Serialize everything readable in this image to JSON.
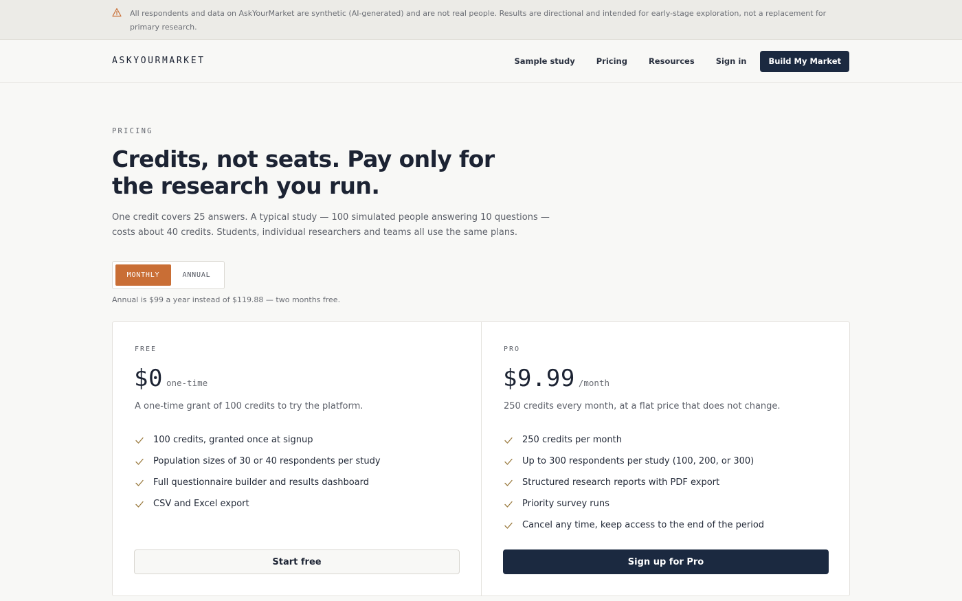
{
  "banner": {
    "icon": "warning-triangle-icon",
    "text": "All respondents and data on AskYourMarket are synthetic (AI-generated) and are not real people. Results are directional and intended for early-stage exploration, not a replacement for primary research."
  },
  "nav": {
    "logo": "ASKYOURMARKET",
    "links": [
      "Sample study",
      "Pricing",
      "Resources",
      "Sign in"
    ],
    "cta": "Build My Market"
  },
  "hero": {
    "eyebrow": "PRICING",
    "headline": "Credits, not seats. Pay only for the research you run.",
    "lede": "One credit covers 25 answers. A typical study — 100 simulated people answering 10 questions — costs about 40 credits. Students, individual researchers and teams all use the same plans."
  },
  "billing": {
    "options": [
      "MONTHLY",
      "ANNUAL"
    ],
    "selected": "MONTHLY",
    "note": "Annual is $99 a year instead of $119.88 — two months free."
  },
  "plans": [
    {
      "name": "FREE",
      "price": "$0",
      "period": "one-time",
      "description": "A one-time grant of 100 credits to try the platform.",
      "features": [
        "100 credits, granted once at signup",
        "Population sizes of 30 or 40 respondents per study",
        "Full questionnaire builder and results dashboard",
        "CSV and Excel export"
      ],
      "button": "Start free"
    },
    {
      "name": "PRO",
      "price": "$9.99",
      "period": "/month",
      "description": "250 credits every month, at a flat price that does not change.",
      "features": [
        "250 credits per month",
        "Up to 300 respondents per study (100, 200, or 300)",
        "Structured research reports with PDF export",
        "Priority survey runs",
        "Cancel any time, keep access to the end of the period"
      ],
      "button": "Sign up for Pro"
    }
  ],
  "colors": {
    "accent": "#c96e35",
    "navy": "#1b2940",
    "check": "#9a7a3e",
    "warning": "#c96e35"
  }
}
